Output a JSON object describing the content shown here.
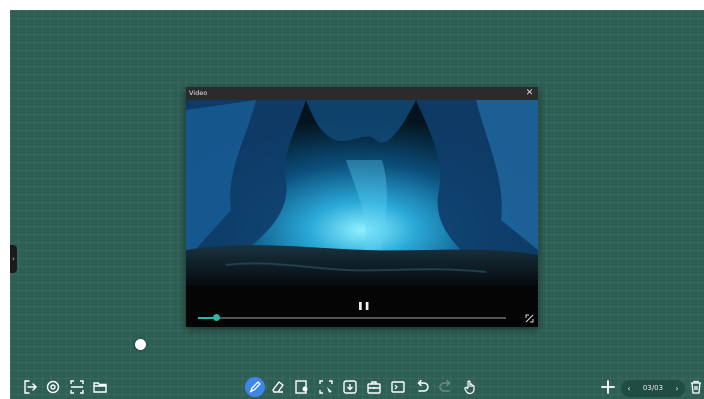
{
  "video_player": {
    "title": "Video",
    "close_icon": "close-icon",
    "pause_icon": "pause-icon",
    "fullscreen_icon": "fullscreen-icon",
    "playback_progress": 0.06
  },
  "left_toolbar": [
    {
      "icon": "exit-icon"
    },
    {
      "icon": "settings-icon"
    },
    {
      "icon": "capture-icon"
    },
    {
      "icon": "folder-icon"
    }
  ],
  "center_toolbar": [
    {
      "icon": "pen-icon",
      "active": true
    },
    {
      "icon": "eraser-icon"
    },
    {
      "icon": "shape-icon"
    },
    {
      "icon": "select-icon"
    },
    {
      "icon": "download-icon"
    },
    {
      "icon": "toolbox-icon"
    },
    {
      "icon": "screen-icon"
    },
    {
      "icon": "undo-icon"
    },
    {
      "icon": "redo-icon"
    },
    {
      "icon": "hand-icon"
    }
  ],
  "pager": {
    "label": "03/03",
    "prev_glyph": "‹",
    "next_glyph": "›"
  },
  "right_toolbar": [
    {
      "icon": "add-page-icon"
    },
    {
      "icon": "delete-icon"
    }
  ],
  "side_tab_glyph": "›",
  "colors": {
    "board": "#2e5f55",
    "accent": "#3d86e8",
    "progress": "#2fb5a5"
  }
}
